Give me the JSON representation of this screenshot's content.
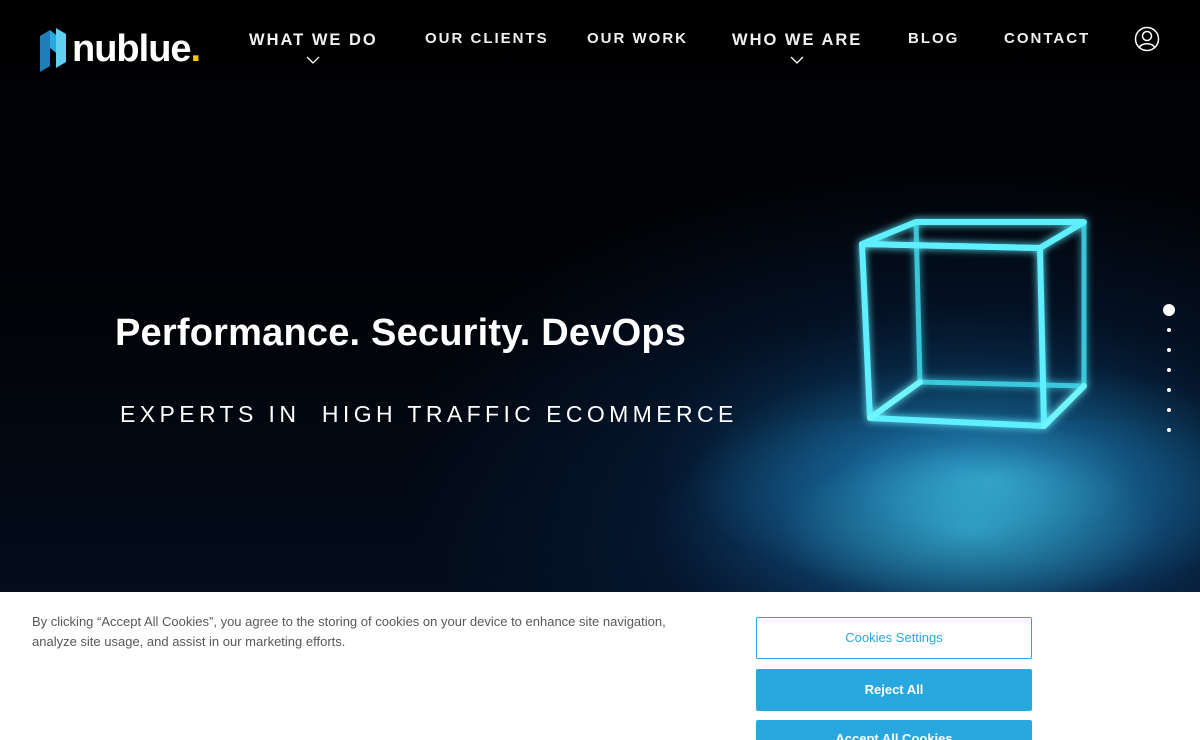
{
  "brand": {
    "name": "nublue",
    "dot": ".",
    "dot_color": "#f5c518",
    "mark_colors": [
      "#1e7fb8",
      "#29a8e0",
      "#5fd0f0"
    ]
  },
  "nav": {
    "items": [
      {
        "label": "WHAT WE DO",
        "has_dropdown": true
      },
      {
        "label": "OUR CLIENTS",
        "has_dropdown": false
      },
      {
        "label": "OUR WORK",
        "has_dropdown": false
      },
      {
        "label": "WHO WE ARE",
        "has_dropdown": true
      },
      {
        "label": "BLOG",
        "has_dropdown": false
      },
      {
        "label": "CONTACT",
        "has_dropdown": false
      }
    ],
    "user_icon": "user-account-icon"
  },
  "hero": {
    "headline": "Performance. Security. DevOps",
    "subline": "EXPERTS IN  HIGH TRAFFIC ECOMMERCE",
    "glow_color": "#5ff0ff"
  },
  "slider": {
    "slide_count": 7,
    "active_index": 0
  },
  "cookie_banner": {
    "text": "By clicking “Accept All Cookies”, you agree to the storing of cookies on your device to enhance site navigation, analyze site usage, and assist in our marketing efforts.",
    "settings_label": "Cookies Settings",
    "reject_label": "Reject All",
    "accept_label": "Accept All Cookies",
    "accent_color": "#29a8e0"
  }
}
